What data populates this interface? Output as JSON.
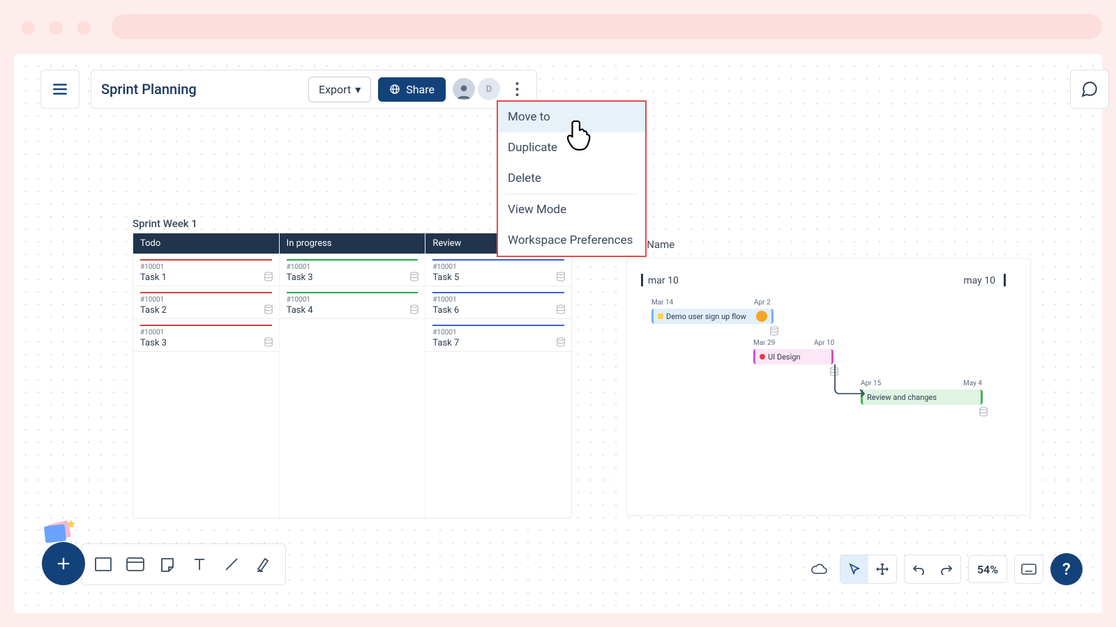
{
  "header": {
    "title": "Sprint Planning",
    "export_label": "Export",
    "share_label": "Share",
    "avatar2_initial": "D"
  },
  "dropdown": {
    "items": [
      {
        "label": "Move to",
        "active": true
      },
      {
        "label": "Duplicate",
        "active": false
      },
      {
        "label": "Delete",
        "active": false
      }
    ],
    "items2": [
      {
        "label": "View Mode"
      },
      {
        "label": "Workspace Preferences"
      }
    ]
  },
  "board": {
    "title": "Sprint Week 1",
    "columns": [
      {
        "name": "Todo",
        "accent": "red",
        "cards": [
          {
            "id": "#10001",
            "title": "Task 1"
          },
          {
            "id": "#10001",
            "title": "Task 2"
          },
          {
            "id": "#10001",
            "title": "Task 3"
          }
        ]
      },
      {
        "name": "In progress",
        "accent": "green",
        "cards": [
          {
            "id": "#10001",
            "title": "Task 3"
          },
          {
            "id": "#10001",
            "title": "Task 4"
          }
        ]
      },
      {
        "name": "Review",
        "accent": "blue",
        "cards": [
          {
            "id": "#10001",
            "title": "Task 5"
          },
          {
            "id": "#10001",
            "title": "Task 6"
          },
          {
            "id": "#10001",
            "title": "Task 7"
          }
        ]
      }
    ]
  },
  "timeline": {
    "label": "line Name",
    "start_label": "mar 10",
    "end_label": "may 10",
    "bars": [
      {
        "start": "Mar 14",
        "end": "Apr 2",
        "title": "Demo user sign up flow",
        "color": "#e1effa",
        "edge": "#6fb2f5"
      },
      {
        "start": "Mar 29",
        "end": "Apr 10",
        "title": "UI Design",
        "color": "#fde6f5",
        "edge": "#d74fc1"
      },
      {
        "start": "Apr 15",
        "end": "May 4",
        "title": "Review and changes",
        "color": "#dff4e3",
        "edge": "#3fb661"
      }
    ]
  },
  "bottom": {
    "zoom": "54%",
    "help": "?"
  }
}
